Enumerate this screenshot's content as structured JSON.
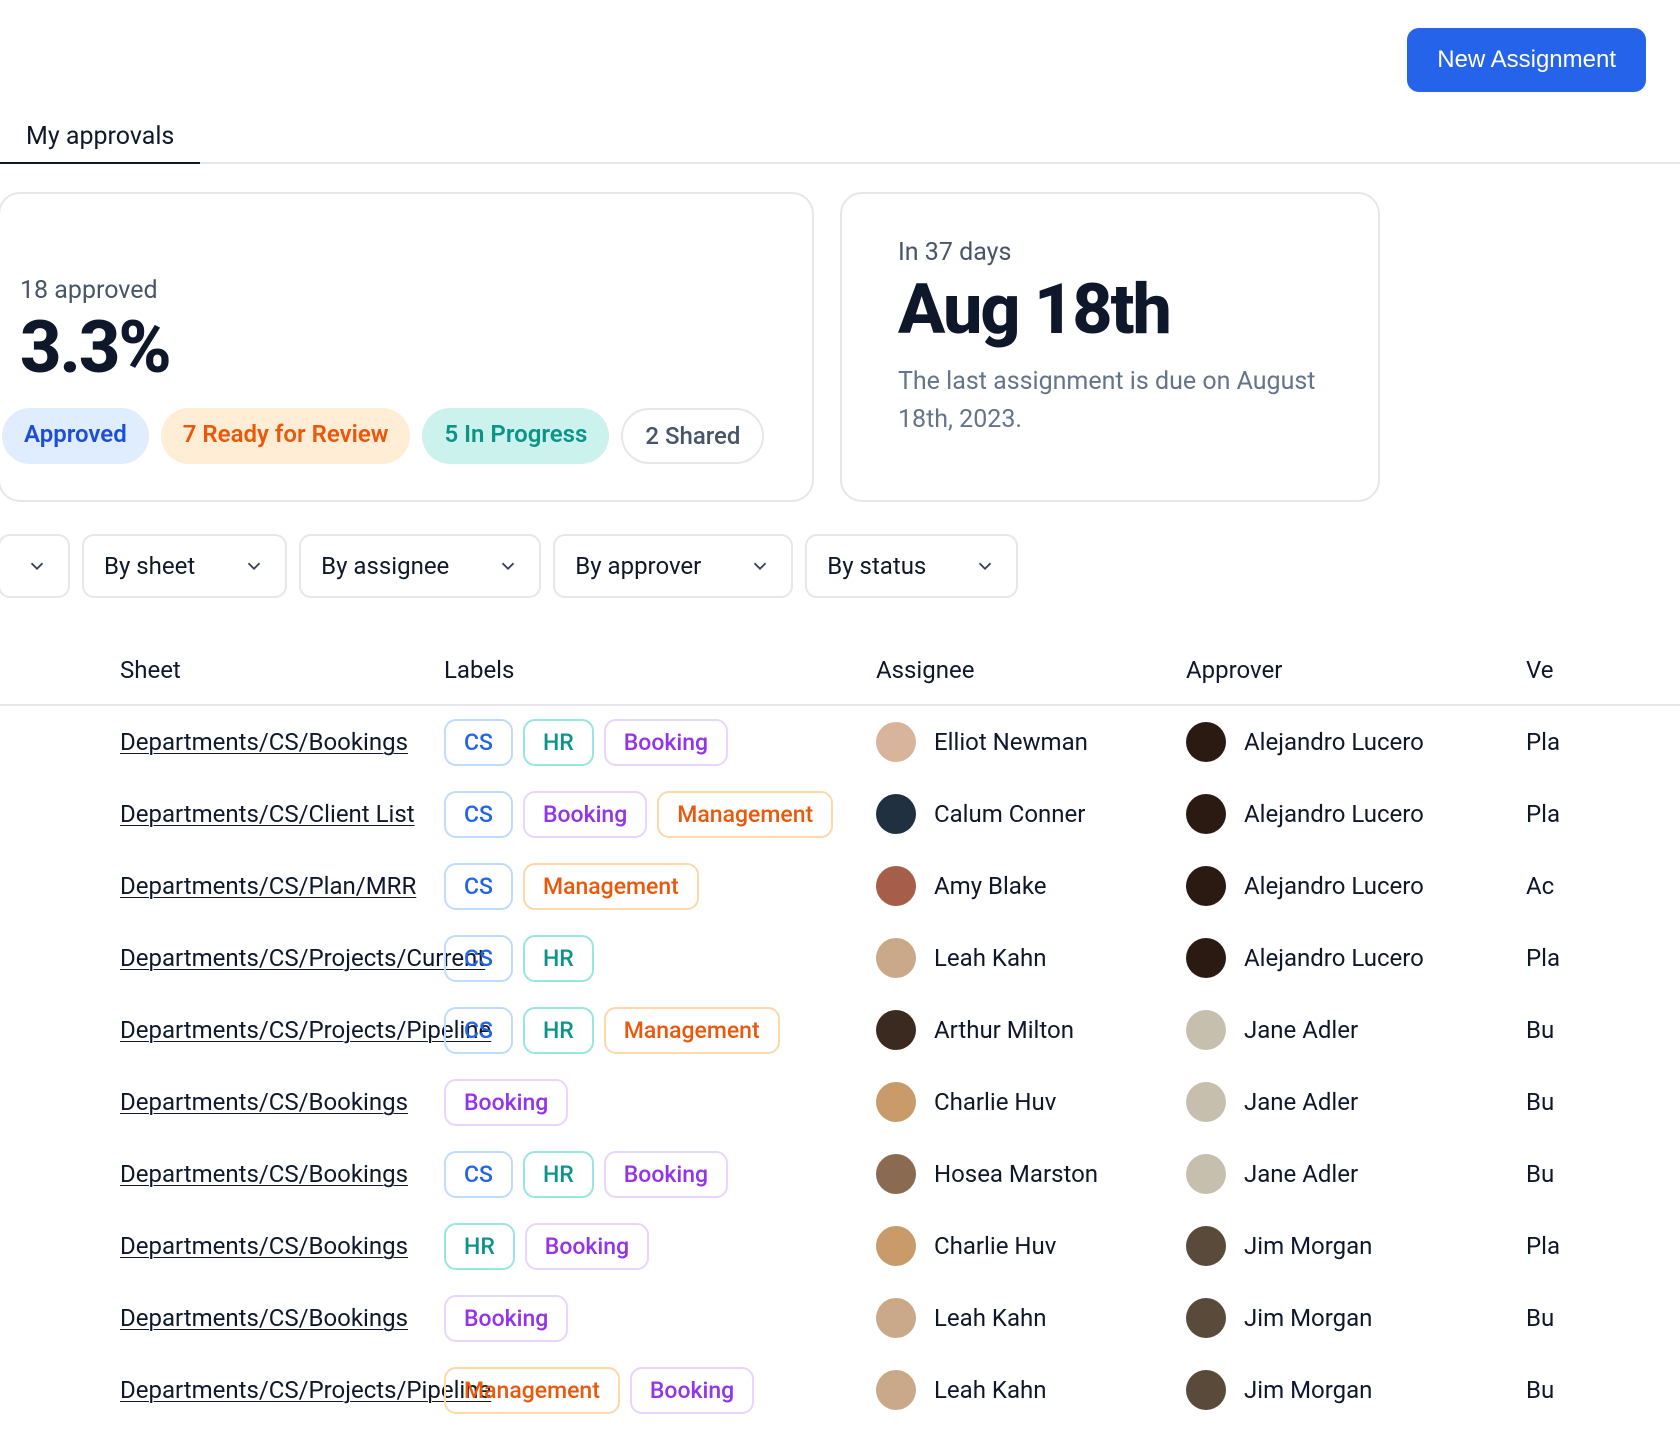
{
  "header": {
    "new_assignment": "New Assignment"
  },
  "tabs": {
    "my_approvals": "My approvals"
  },
  "summary": {
    "approved_line": "18 approved",
    "pct": "3.3%",
    "pill_approved": "Approved",
    "pill_ready": "7 Ready for Review",
    "pill_progress": "5 In Progress",
    "pill_shared": "2 Shared"
  },
  "due": {
    "in_days": "In 37 days",
    "date": "Aug 18th",
    "desc": "The last assignment is due on August 18th, 2023."
  },
  "filters": {
    "by_sheet": "By sheet",
    "by_assignee": "By assignee",
    "by_approver": "By approver",
    "by_status": "By status"
  },
  "columns": {
    "sheet": "Sheet",
    "labels": "Labels",
    "assignee": "Assignee",
    "approver": "Approver",
    "ver": "Ve"
  },
  "label_names": {
    "cs": "CS",
    "hr": "HR",
    "booking": "Booking",
    "mgmt": "Management"
  },
  "avatars": {
    "elliot": "#d9b49c",
    "calum": "#203040",
    "amy": "#a65d4a",
    "leah": "#caa88a",
    "arthur": "#3a2a20",
    "charlie": "#c99a6a",
    "hosea": "#8a6a50",
    "alejandro": "#2a1a12",
    "jane": "#c7bfae",
    "jim": "#5a4a3a"
  },
  "rows": [
    {
      "sheet": "Departments/CS/Bookings",
      "labels": [
        "cs",
        "hr",
        "booking"
      ],
      "assignee": {
        "name": "Elliot Newman",
        "av": "elliot"
      },
      "approver": {
        "name": "Alejandro Lucero",
        "av": "alejandro"
      },
      "ver": "Pla"
    },
    {
      "sheet": "Departments/CS/Client List",
      "labels": [
        "cs",
        "booking",
        "mgmt"
      ],
      "assignee": {
        "name": "Calum Conner",
        "av": "calum"
      },
      "approver": {
        "name": "Alejandro Lucero",
        "av": "alejandro"
      },
      "ver": "Pla"
    },
    {
      "sheet": "Departments/CS/Plan/MRR",
      "labels": [
        "cs",
        "mgmt"
      ],
      "assignee": {
        "name": "Amy Blake",
        "av": "amy"
      },
      "approver": {
        "name": "Alejandro Lucero",
        "av": "alejandro"
      },
      "ver": "Ac"
    },
    {
      "sheet": "Departments/CS/Projects/Current",
      "labels": [
        "cs",
        "hr"
      ],
      "assignee": {
        "name": "Leah Kahn",
        "av": "leah"
      },
      "approver": {
        "name": "Alejandro Lucero",
        "av": "alejandro"
      },
      "ver": "Pla"
    },
    {
      "sheet": "Departments/CS/Projects/Pipeline",
      "labels": [
        "cs",
        "hr",
        "mgmt"
      ],
      "assignee": {
        "name": "Arthur Milton",
        "av": "arthur"
      },
      "approver": {
        "name": "Jane Adler",
        "av": "jane"
      },
      "ver": "Bu"
    },
    {
      "sheet": "Departments/CS/Bookings",
      "labels": [
        "booking"
      ],
      "assignee": {
        "name": "Charlie Huv",
        "av": "charlie"
      },
      "approver": {
        "name": "Jane Adler",
        "av": "jane"
      },
      "ver": "Bu"
    },
    {
      "sheet": "Departments/CS/Bookings",
      "labels": [
        "cs",
        "hr",
        "booking"
      ],
      "assignee": {
        "name": "Hosea Marston",
        "av": "hosea"
      },
      "approver": {
        "name": "Jane Adler",
        "av": "jane"
      },
      "ver": "Bu"
    },
    {
      "sheet": "Departments/CS/Bookings",
      "labels": [
        "hr",
        "booking"
      ],
      "assignee": {
        "name": "Charlie Huv",
        "av": "charlie"
      },
      "approver": {
        "name": "Jim Morgan",
        "av": "jim"
      },
      "ver": "Pla"
    },
    {
      "sheet": "Departments/CS/Bookings",
      "labels": [
        "booking"
      ],
      "assignee": {
        "name": "Leah Kahn",
        "av": "leah"
      },
      "approver": {
        "name": "Jim Morgan",
        "av": "jim"
      },
      "ver": "Bu"
    },
    {
      "sheet": "Departments/CS/Projects/Pipeline",
      "labels": [
        "mgmt",
        "booking"
      ],
      "assignee": {
        "name": "Leah Kahn",
        "av": "leah"
      },
      "approver": {
        "name": "Jim Morgan",
        "av": "jim"
      },
      "ver": "Bu"
    }
  ]
}
